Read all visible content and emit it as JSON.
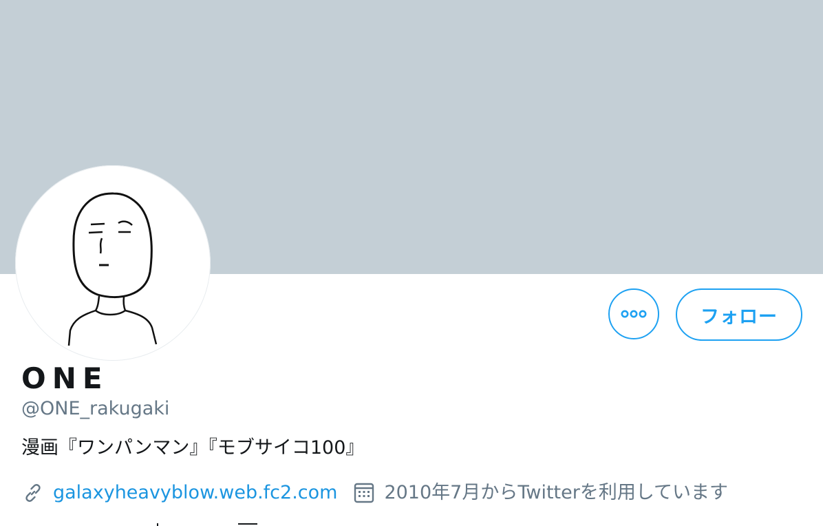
{
  "profile": {
    "display_name": "ONE",
    "handle": "@ONE_rakugaki",
    "bio": "漫画『ワンパンマン』『モブサイコ100』",
    "website": "galaxyheavyblow.web.fc2.com",
    "joined": "2010年7月からTwitterを利用しています"
  },
  "actions": {
    "more_icon": "more-dots-icon",
    "follow_label": "フォロー"
  },
  "icons": {
    "link": "link-icon",
    "calendar": "calendar-icon"
  },
  "colors": {
    "banner": "#c4cfd6",
    "accent": "#1da1f2",
    "link": "#1b95e0",
    "secondary_text": "#657786",
    "primary_text": "#14171a"
  }
}
